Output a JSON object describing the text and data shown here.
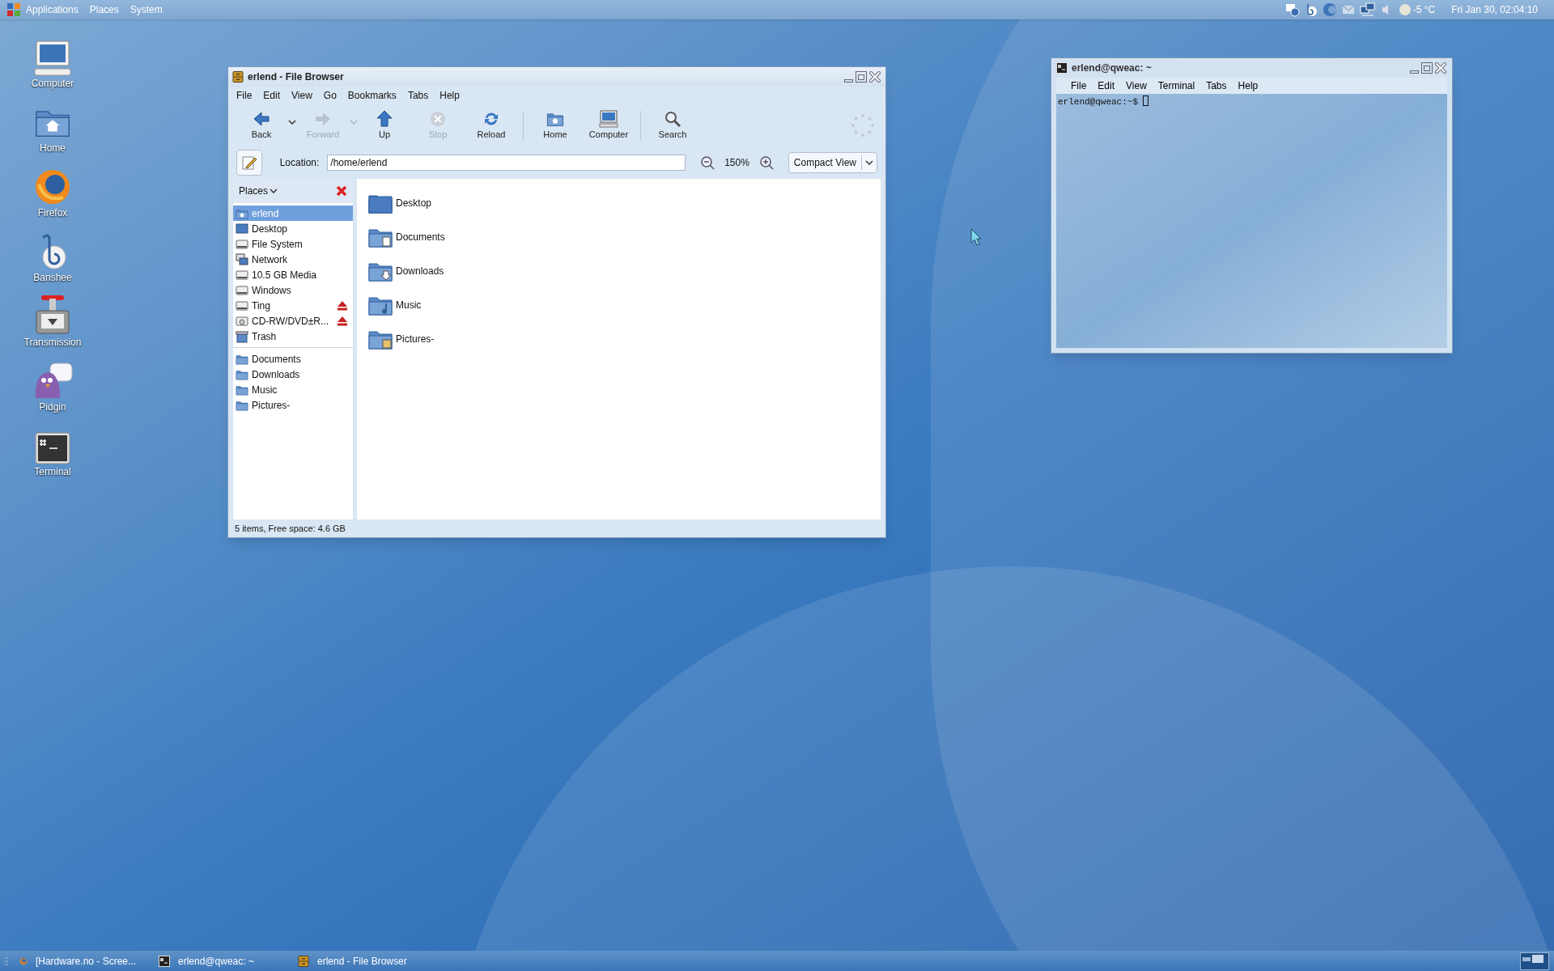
{
  "top_panel": {
    "menus": [
      "Applications",
      "Places",
      "System"
    ],
    "temperature": "-5 °C",
    "clock": "Fri Jan 30, 02:04:10"
  },
  "desktop_icons": [
    {
      "label": "Computer",
      "kind": "computer"
    },
    {
      "label": "Home",
      "kind": "home"
    },
    {
      "label": "Firefox",
      "kind": "firefox"
    },
    {
      "label": "Banshee",
      "kind": "banshee"
    },
    {
      "label": "Transmission",
      "kind": "transmission"
    },
    {
      "label": "Pidgin",
      "kind": "pidgin"
    },
    {
      "label": "Terminal",
      "kind": "terminal"
    }
  ],
  "file_browser": {
    "title": "erlend - File Browser",
    "menus": [
      "File",
      "Edit",
      "View",
      "Go",
      "Bookmarks",
      "Tabs",
      "Help"
    ],
    "toolbar_groups": [
      {
        "buttons": [
          {
            "label": "Back",
            "kind": "back",
            "disabled": false,
            "has_menu": true
          },
          {
            "label": "Forward",
            "kind": "forward",
            "disabled": true,
            "has_menu": true
          },
          {
            "label": "Up",
            "kind": "up",
            "disabled": false,
            "has_menu": false
          },
          {
            "label": "Stop",
            "kind": "stop",
            "disabled": true,
            "has_menu": false
          },
          {
            "label": "Reload",
            "kind": "reload",
            "disabled": false,
            "has_menu": false
          }
        ]
      },
      {
        "buttons": [
          {
            "label": "Home",
            "kind": "home",
            "disabled": false,
            "has_menu": false
          },
          {
            "label": "Computer",
            "kind": "computer",
            "disabled": false,
            "has_menu": false
          }
        ]
      },
      {
        "buttons": [
          {
            "label": "Search",
            "kind": "search",
            "disabled": false,
            "has_menu": false
          }
        ]
      }
    ],
    "location_label": "Location:",
    "location": "/home/erlend",
    "zoom": "150%",
    "view": "Compact View",
    "sidebar_title": "Places",
    "places": [
      {
        "label": "erlend",
        "kind": "home",
        "selected": true,
        "eject": false
      },
      {
        "label": "Desktop",
        "kind": "desktop",
        "selected": false,
        "eject": false
      },
      {
        "label": "File System",
        "kind": "drive",
        "selected": false,
        "eject": false
      },
      {
        "label": "Network",
        "kind": "network",
        "selected": false,
        "eject": false
      },
      {
        "label": "10.5 GB Media",
        "kind": "drive",
        "selected": false,
        "eject": false
      },
      {
        "label": "Windows",
        "kind": "drive",
        "selected": false,
        "eject": false
      },
      {
        "label": "Ting",
        "kind": "drive",
        "selected": false,
        "eject": true
      },
      {
        "label": "CD-RW/DVD±R...",
        "kind": "optical",
        "selected": false,
        "eject": true
      },
      {
        "label": "Trash",
        "kind": "trash",
        "selected": false,
        "eject": false
      }
    ],
    "bookmarks": [
      {
        "label": "Documents",
        "selected": false
      },
      {
        "label": "Downloads",
        "selected": false
      },
      {
        "label": "Music",
        "selected": false
      },
      {
        "label": "Pictures-",
        "selected": false
      }
    ],
    "files": [
      {
        "name": "Desktop",
        "kind": "desktop",
        "selected": false
      },
      {
        "name": "Documents",
        "kind": "documents",
        "selected": false
      },
      {
        "name": "Downloads",
        "kind": "downloads",
        "selected": false
      },
      {
        "name": "Music",
        "kind": "music",
        "selected": false
      },
      {
        "name": "Pictures-",
        "kind": "pictures",
        "selected": false
      }
    ],
    "status": "5 items, Free space: 4.6 GB"
  },
  "terminal": {
    "title": "erlend@qweac: ~",
    "menus": [
      "File",
      "Edit",
      "View",
      "Terminal",
      "Tabs",
      "Help"
    ],
    "prompt": "erlend@qweac:~$"
  },
  "taskbar": {
    "items": [
      {
        "label": "[Hardware.no - Scree...",
        "kind": "firefox"
      },
      {
        "label": "erlend@qweac: ~",
        "kind": "terminal"
      },
      {
        "label": "erlend - File Browser",
        "kind": "filebrowser"
      }
    ]
  }
}
